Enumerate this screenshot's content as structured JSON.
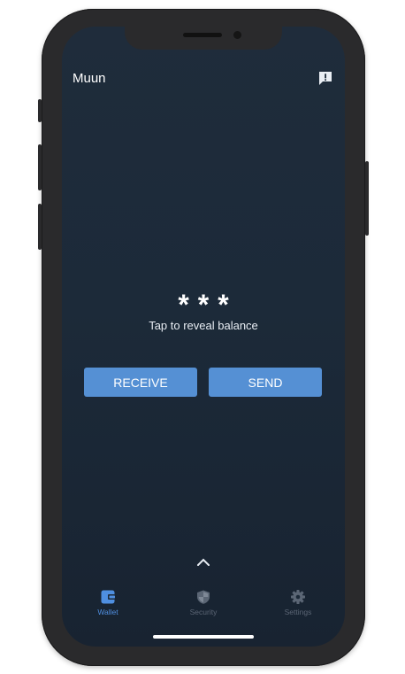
{
  "app": {
    "title": "Muun"
  },
  "balance": {
    "masked": "***",
    "hint": "Tap to reveal balance"
  },
  "actions": {
    "receive_label": "RECEIVE",
    "send_label": "SEND"
  },
  "nav": {
    "items": [
      {
        "label": "Wallet",
        "icon": "wallet-icon",
        "active": true
      },
      {
        "label": "Security",
        "icon": "shield-icon",
        "active": false
      },
      {
        "label": "Settings",
        "icon": "gear-icon",
        "active": false
      }
    ]
  },
  "colors": {
    "accent": "#5590d4",
    "background": "#1c2a39",
    "nav_active": "#4f8fe0",
    "nav_inactive": "#5b6675"
  }
}
